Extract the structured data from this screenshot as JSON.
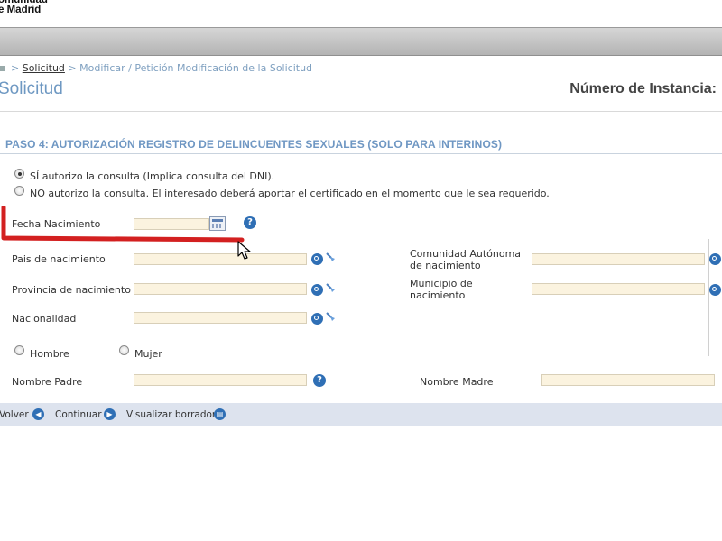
{
  "header": {
    "logo_line1": "omunidad",
    "logo_line2": "e Madrid"
  },
  "breadcrumb": {
    "sep1": ">",
    "link": "Solicitud",
    "sep2": ">",
    "rest": "Modificar / Petición Modificación de la Solicitud"
  },
  "page": {
    "title": "Solicitud",
    "instance_label": "Número de Instancia:"
  },
  "step": {
    "title": "PASO 4: AUTORIZACIÓN REGISTRO DE DELINCUENTES SEXUALES (SOLO PARA INTERINOS)"
  },
  "consent": {
    "yes_label": "SÍ autorizo la consulta (Implica consulta del DNI).",
    "no_label": "NO autorizo la consulta. El interesado deberá aportar el certificado en el momento que le sea requerido.",
    "selected": "yes"
  },
  "fields": {
    "fecha_nacimiento": "Fecha Nacimiento",
    "pais_nacimiento": "Pais de nacimiento",
    "comunidad_line1": "Comunidad Autónoma",
    "comunidad_line2": "de nacimiento",
    "provincia_nacimiento": "Provincia de nacimiento",
    "municipio_line1": "Municipio de",
    "municipio_line2": "nacimiento",
    "nacionalidad": "Nacionalidad",
    "hombre": "Hombre",
    "mujer": "Mujer",
    "nombre_padre": "Nombre Padre",
    "nombre_madre": "Nombre Madre"
  },
  "icons": {
    "help_glyph": "?",
    "prev_glyph": "◀",
    "next_glyph": "▶",
    "doc_glyph": "▤"
  },
  "footer": {
    "volver": "Volver",
    "continuar": "Continuar",
    "visualizar": "Visualizar borrador"
  },
  "colors": {
    "accent": "#6f97c3",
    "input_bg": "#fbf3df",
    "annotation_red": "#d32020",
    "icon_blue": "#2f6fb5"
  }
}
